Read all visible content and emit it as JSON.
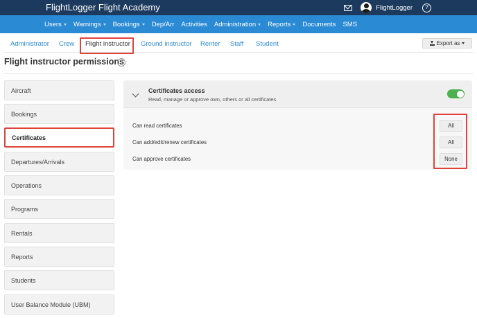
{
  "app": {
    "title": "FlightLogger Flight Academy",
    "user_name": "FlightLogger",
    "help_glyph": "?"
  },
  "nav": {
    "items": [
      {
        "label": "Users",
        "dropdown": true
      },
      {
        "label": "Warnings",
        "dropdown": true
      },
      {
        "label": "Bookings",
        "dropdown": true
      },
      {
        "label": "Dep/Arr",
        "dropdown": false
      },
      {
        "label": "Activities",
        "dropdown": false
      },
      {
        "label": "Administration",
        "dropdown": true
      },
      {
        "label": "Reports",
        "dropdown": true
      },
      {
        "label": "Documents",
        "dropdown": false
      },
      {
        "label": "SMS",
        "dropdown": false
      }
    ]
  },
  "tabs": {
    "items": [
      {
        "label": "Administrator"
      },
      {
        "label": "Crew"
      },
      {
        "label": "Flight instructor"
      },
      {
        "label": "Ground instructor"
      },
      {
        "label": "Renter"
      },
      {
        "label": "Staff"
      },
      {
        "label": "Student"
      }
    ],
    "active_index": 2,
    "export_label": "Export as"
  },
  "page": {
    "title": "Flight instructor permissions",
    "help_glyph": "?"
  },
  "sidebar": {
    "items": [
      {
        "label": "Aircraft"
      },
      {
        "label": "Bookings"
      },
      {
        "label": "Certificates"
      },
      {
        "label": "Departures/Arrivals"
      },
      {
        "label": "Operations"
      },
      {
        "label": "Programs"
      },
      {
        "label": "Rentals"
      },
      {
        "label": "Reports"
      },
      {
        "label": "Students"
      },
      {
        "label": "User Balance Module (UBM)"
      }
    ],
    "active_index": 2
  },
  "panel": {
    "title": "Certificates access",
    "subtitle": "Read, manage or approve own, others or all certificates",
    "enabled": true,
    "permissions": [
      {
        "label": "Can read certificates",
        "value": "All"
      },
      {
        "label": "Can add/edit/renew certificates",
        "value": "All"
      },
      {
        "label": "Can approve certificates",
        "value": "None"
      }
    ]
  },
  "colors": {
    "topbar": "#1c3a5e",
    "navbar": "#2b8ad4",
    "link": "#2b8ad4",
    "highlight": "#e0433b",
    "toggle_on": "#4caf50"
  }
}
